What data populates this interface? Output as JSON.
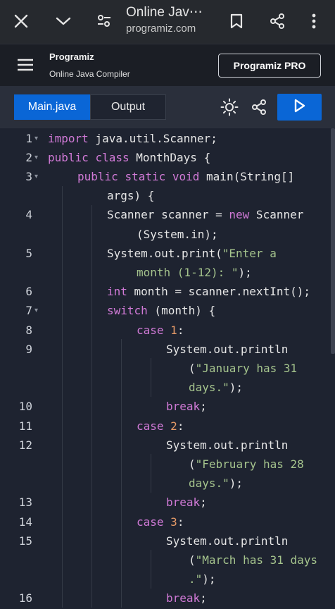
{
  "browser": {
    "title": "Online Jav⋯",
    "url": "programiz.com"
  },
  "site": {
    "logo": "Programiz",
    "subtitle": "Online Java Compiler",
    "pro_button": "Programiz PRO"
  },
  "toolbar": {
    "tabs": [
      "Main.java",
      "Output"
    ]
  },
  "editor": {
    "lines": [
      {
        "num": "1",
        "fold": true,
        "text": "import java.util.Scanner;"
      },
      {
        "num": "2",
        "fold": true,
        "text": "public class MonthDays {"
      },
      {
        "num": "3",
        "fold": true,
        "text": "public static void main(String[]"
      },
      {
        "num": "",
        "fold": false,
        "text": "args) {"
      },
      {
        "num": "4",
        "fold": false,
        "text": "Scanner scanner = new Scanner"
      },
      {
        "num": "",
        "fold": false,
        "text": "(System.in);"
      },
      {
        "num": "5",
        "fold": false,
        "text": "System.out.print(\"Enter a"
      },
      {
        "num": "",
        "fold": false,
        "text": "month (1-12): \");"
      },
      {
        "num": "6",
        "fold": false,
        "text": "int month = scanner.nextInt();"
      },
      {
        "num": "7",
        "fold": true,
        "text": "switch (month) {"
      },
      {
        "num": "8",
        "fold": false,
        "text": "case 1:"
      },
      {
        "num": "9",
        "fold": false,
        "text": "System.out.println"
      },
      {
        "num": "",
        "fold": false,
        "text": "(\"January has 31"
      },
      {
        "num": "",
        "fold": false,
        "text": "days.\");"
      },
      {
        "num": "10",
        "fold": false,
        "text": "break;"
      },
      {
        "num": "11",
        "fold": false,
        "text": "case 2:"
      },
      {
        "num": "12",
        "fold": false,
        "text": "System.out.println"
      },
      {
        "num": "",
        "fold": false,
        "text": "(\"February has 28"
      },
      {
        "num": "",
        "fold": false,
        "text": "days.\");"
      },
      {
        "num": "13",
        "fold": false,
        "text": "break;"
      },
      {
        "num": "14",
        "fold": false,
        "text": "case 3:"
      },
      {
        "num": "15",
        "fold": false,
        "text": "System.out.println"
      },
      {
        "num": "",
        "fold": false,
        "text": "(\"March has 31 days"
      },
      {
        "num": "",
        "fold": false,
        "text": ".\");"
      },
      {
        "num": "16",
        "fold": false,
        "text": "break;"
      }
    ]
  },
  "icons": {
    "close": "close-icon",
    "chevron": "chevron-down-icon",
    "site_settings": "tune-icon",
    "bookmark": "bookmark-icon",
    "share": "share-icon",
    "more": "more-vert-icon",
    "menu": "hamburger-menu-icon",
    "theme": "sun-icon",
    "share_code": "share-icon",
    "run": "play-icon"
  },
  "colors": {
    "accent": "#0a66d6",
    "editor_bg": "#1e2330",
    "keyword": "#d17ad7",
    "string": "#a5c48d",
    "number": "#e59a67"
  }
}
